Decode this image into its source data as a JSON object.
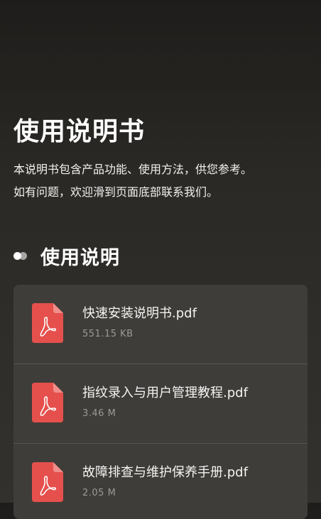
{
  "header": {
    "title": "使用说明书",
    "intro_line1": "本说明书包含产品功能、使用方法，供您参考。",
    "intro_line2": "如有问题，欢迎滑到页面底部联系我们。"
  },
  "section": {
    "title": "使用说明"
  },
  "files": [
    {
      "name": "快速安装说明书.pdf",
      "size": "551.15 KB",
      "icon": "pdf-file-icon"
    },
    {
      "name": "指纹录入与用户管理教程.pdf",
      "size": "3.46 M",
      "icon": "pdf-file-icon"
    },
    {
      "name": "故障排查与维护保养手册.pdf",
      "size": "2.05 M",
      "icon": "pdf-file-icon"
    }
  ],
  "colors": {
    "pdf_red": "#e5504d",
    "background": "#2a2925",
    "card": "#3f3d39"
  }
}
